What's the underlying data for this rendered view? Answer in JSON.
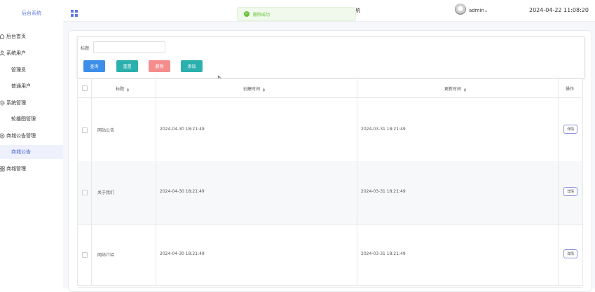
{
  "sidebar": {
    "brand": "后台系统",
    "items": [
      {
        "label": "后台首页",
        "icon": "home-icon"
      },
      {
        "label": "系统用户",
        "icon": "user-icon"
      },
      {
        "label": "管理员"
      },
      {
        "label": "普通用户"
      },
      {
        "label": "系统管理",
        "icon": "gear-icon"
      },
      {
        "label": "轮播图管理"
      },
      {
        "label": "商城公告管理",
        "icon": "settings-icon"
      },
      {
        "label": "商城公告"
      },
      {
        "label": "商城管理",
        "icon": "grid-icon"
      }
    ]
  },
  "header": {
    "title": "统",
    "user": "admin",
    "datetime": "2024-04-22 11:08:20"
  },
  "toast": {
    "message": "删除成功"
  },
  "filter": {
    "label": "标题",
    "input_value": "",
    "buttons": {
      "query": "查询",
      "reset": "重置",
      "delete": "删除",
      "add": "添加"
    }
  },
  "table": {
    "columns": [
      "标题",
      "创建时间",
      "更新时间",
      "操作"
    ],
    "rows": [
      {
        "title": "网站公告",
        "created": "2024-04-30 18:21:49",
        "updated": "2024-03-31 18:21:49",
        "action": "详情"
      },
      {
        "title": "关于我们",
        "created": "2024-04-30 18:21:49",
        "updated": "2024-03-31 18:21:49",
        "action": "详情"
      },
      {
        "title": "网站介绍",
        "created": "2024-04-30 18:21:49",
        "updated": "2024-03-31 18:21:49",
        "action": "详情"
      }
    ]
  },
  "colors": {
    "accent": "#4a63d6",
    "success": "#67c23a",
    "query_button": "#3d8ee8",
    "teal_button": "#2bb0ad",
    "delete_button": "#f58d8d"
  }
}
